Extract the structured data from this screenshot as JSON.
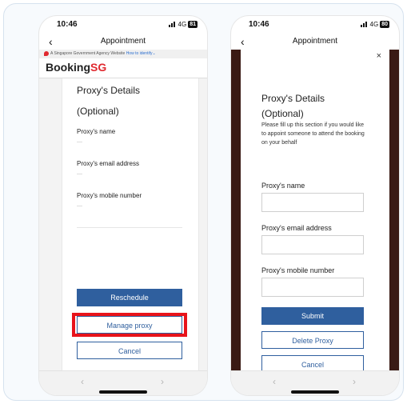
{
  "left": {
    "status_time": "10:46",
    "status_net": "4G",
    "status_batt": "81",
    "nav_title": "Appointment",
    "gov_text": "A Singapore Government Agency Website",
    "gov_link": "How to identify",
    "brand_main": "Booking",
    "brand_sg": "SG",
    "title_line1": "Proxy's Details",
    "title_line2": "(Optional)",
    "label_name": "Proxy's name",
    "value_name": "—",
    "label_email": "Proxy's email address",
    "value_email": "—",
    "label_mobile": "Proxy's mobile number",
    "value_mobile": "—",
    "btn_reschedule": "Reschedule",
    "btn_manage": "Manage proxy",
    "btn_cancel": "Cancel"
  },
  "right": {
    "status_time": "10:46",
    "status_net": "4G",
    "status_batt": "80",
    "nav_title": "Appointment",
    "close": "×",
    "title_line1": "Proxy's Details",
    "title_line2": "(Optional)",
    "description": "Please fill up this section if you would like to appoint someone to attend the booking on your behalf",
    "label_name": "Proxy's name",
    "label_email": "Proxy's email address",
    "label_mobile": "Proxy's mobile number",
    "btn_submit": "Submit",
    "btn_delete": "Delete Proxy",
    "btn_cancel": "Cancel"
  },
  "icons": {
    "back": "‹",
    "prev": "‹",
    "next": "›"
  },
  "colors": {
    "primary": "#2f5f9e",
    "brand_red": "#e0282e",
    "highlight": "#e8131b",
    "modal_backdrop": "#3a1a14"
  }
}
